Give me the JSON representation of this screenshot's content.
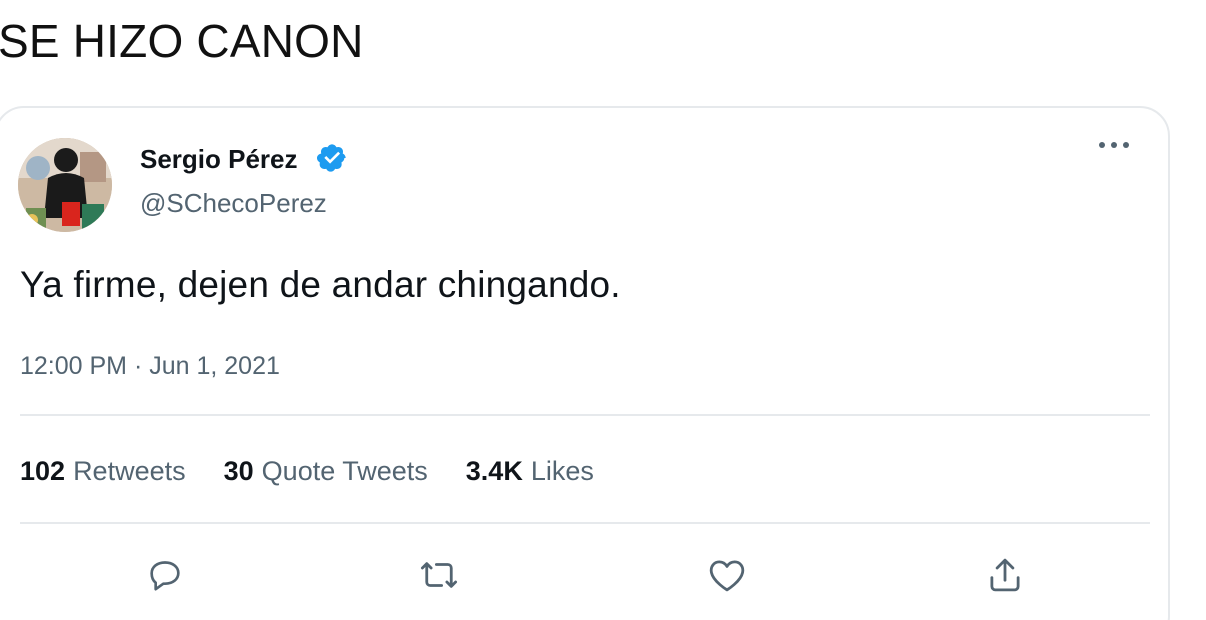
{
  "caption": "SE HIZO CANON",
  "tweet": {
    "author_name": "Sergio Pérez",
    "author_handle": "@SChecoPerez",
    "verified": true,
    "text": "Ya firme, dejen de andar chingando.",
    "timestamp": "12:00 PM · Jun 1, 2021",
    "stats": {
      "retweets_count": "102",
      "retweets_label": "Retweets",
      "quote_tweets_count": "30",
      "quote_tweets_label": "Quote Tweets",
      "likes_count": "3.4K",
      "likes_label": "Likes"
    },
    "actions": [
      "reply-icon",
      "retweet-icon",
      "like-icon",
      "share-icon"
    ],
    "more_icon": "more-icon"
  },
  "colors": {
    "text_primary": "#0f1419",
    "text_secondary": "#536471",
    "verified_blue": "#1d9bf0",
    "border": "#e6e9ec"
  }
}
